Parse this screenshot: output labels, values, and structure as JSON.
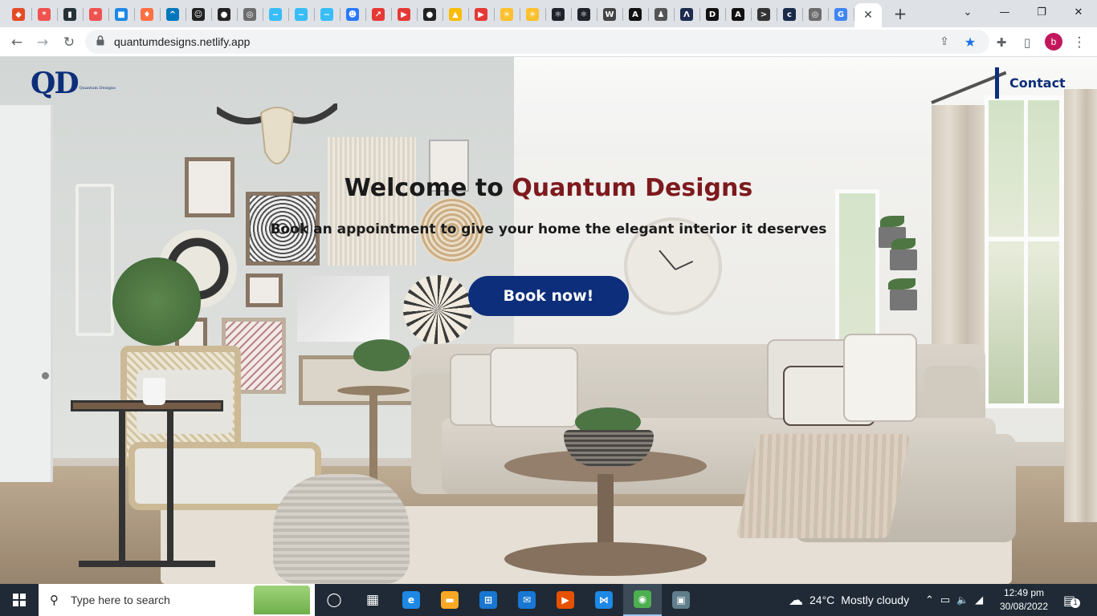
{
  "browser": {
    "tabs": [
      {
        "icon": "generic-favicon",
        "color": "#e34c26",
        "glyph": "◆"
      },
      {
        "icon": "asterisk-favicon",
        "color": "#ef5350",
        "glyph": "*"
      },
      {
        "icon": "chart-favicon",
        "color": "#263238",
        "glyph": "▮"
      },
      {
        "icon": "asterisk-favicon",
        "color": "#ef5350",
        "glyph": "*"
      },
      {
        "icon": "puzzle-favicon",
        "color": "#1e88e5",
        "glyph": "■"
      },
      {
        "icon": "flame-favicon",
        "color": "#ff7043",
        "glyph": "♦"
      },
      {
        "icon": "chevron-favicon",
        "color": "#0277bd",
        "glyph": "^"
      },
      {
        "icon": "face-favicon",
        "color": "#222222",
        "glyph": "☺"
      },
      {
        "icon": "github-favicon",
        "color": "#222222",
        "glyph": "●"
      },
      {
        "icon": "globe-favicon",
        "color": "#6d6d6d",
        "glyph": "◎"
      },
      {
        "icon": "tailwind-favicon",
        "color": "#38bdf8",
        "glyph": "~"
      },
      {
        "icon": "tailwind-favicon",
        "color": "#38bdf8",
        "glyph": "~"
      },
      {
        "icon": "tailwind-favicon",
        "color": "#38bdf8",
        "glyph": "~"
      },
      {
        "icon": "robot-favicon",
        "color": "#2979ff",
        "glyph": "☻"
      },
      {
        "icon": "red-square-favicon",
        "color": "#e53935",
        "glyph": "↗"
      },
      {
        "icon": "youtube-favicon",
        "color": "#e53935",
        "glyph": "▶"
      },
      {
        "icon": "github-favicon",
        "color": "#222222",
        "glyph": "●"
      },
      {
        "icon": "drive-favicon",
        "color": "#fbbc04",
        "glyph": "▲"
      },
      {
        "icon": "youtube-favicon",
        "color": "#e53935",
        "glyph": "▶"
      },
      {
        "icon": "sun-favicon",
        "color": "#fbc02d",
        "glyph": "☀"
      },
      {
        "icon": "sun-favicon",
        "color": "#fbc02d",
        "glyph": "☀"
      },
      {
        "icon": "react-favicon",
        "color": "#20232a",
        "glyph": "⚛"
      },
      {
        "icon": "react-favicon",
        "color": "#20232a",
        "glyph": "⚛"
      },
      {
        "icon": "w-favicon",
        "color": "#444444",
        "glyph": "W"
      },
      {
        "icon": "a-favicon",
        "color": "#111111",
        "glyph": "A"
      },
      {
        "icon": "person-favicon",
        "color": "#555555",
        "glyph": "♟"
      },
      {
        "icon": "a-slash-favicon",
        "color": "#1d2b4f",
        "glyph": "Λ"
      },
      {
        "icon": "d-favicon",
        "color": "#111111",
        "glyph": "D"
      },
      {
        "icon": "a-circle-favicon",
        "color": "#111111",
        "glyph": "A"
      },
      {
        "icon": "terminal-favicon",
        "color": "#333333",
        "glyph": ">"
      },
      {
        "icon": "c-favicon",
        "color": "#1b2a4a",
        "glyph": "c"
      },
      {
        "icon": "globe-favicon",
        "color": "#6d6d6d",
        "glyph": "◎"
      },
      {
        "icon": "google-favicon",
        "color": "#4285f4",
        "glyph": "G"
      }
    ],
    "active_tab_close": "✕",
    "new_tab": "+",
    "window_controls": {
      "dropdown": "⌄",
      "minimize": "—",
      "restore": "❐",
      "close": "✕"
    },
    "nav": {
      "back": "←",
      "forward": "→",
      "reload": "↻"
    },
    "url": "quantumdesigns.netlify.app",
    "omnibox_icons": {
      "share": "⇪",
      "bookmark": "★",
      "extensions": "✚",
      "sidepanel": "▯",
      "menu": "⋮"
    },
    "profile_initial": "b",
    "colors": {
      "tabstrip": "#dee1e6",
      "bookmark_star": "#1a73e8",
      "profile": "#c2185b"
    }
  },
  "site": {
    "logo_mark": "QD",
    "logo_subtitle": "Quantum Designs",
    "nav_contact": "Contact",
    "headline_prefix": "Welcome to ",
    "headline_brand": "Quantum Designs",
    "subheadline": "Book an appointment to give your home the elegant interior it deserves",
    "cta_label": "Book now!",
    "colors": {
      "primary": "#0d2e7a",
      "brand_accent": "#7d1a1d",
      "text": "#1a1a1a"
    },
    "hero_image": "living-room-interior"
  },
  "taskbar": {
    "search_placeholder": "Type here to search",
    "apps": [
      {
        "name": "task-view",
        "glyph": "◯",
        "color": "transparent"
      },
      {
        "name": "task-switcher",
        "glyph": "▦",
        "color": "transparent"
      },
      {
        "name": "edge",
        "glyph": "e",
        "color": "#1e88e5"
      },
      {
        "name": "file-explorer",
        "glyph": "▬",
        "color": "#f9a825"
      },
      {
        "name": "store",
        "glyph": "⊞",
        "color": "#1976d2"
      },
      {
        "name": "mail",
        "glyph": "✉",
        "color": "#1976d2"
      },
      {
        "name": "media-player",
        "glyph": "▶",
        "color": "#e65100"
      },
      {
        "name": "vscode",
        "glyph": "⋈",
        "color": "#1e88e5"
      },
      {
        "name": "chrome",
        "glyph": "◉",
        "color": "#4caf50"
      },
      {
        "name": "remote-desktop",
        "glyph": "▣",
        "color": "#607d8b"
      }
    ],
    "weather_temp": "24°C",
    "weather_text": "Mostly cloudy",
    "tray_icons": {
      "chevron": "⌃",
      "battery": "▭",
      "volume": "🔈",
      "network": "◢"
    },
    "time": "12:49 pm",
    "date": "30/08/2022",
    "notification_count": "1"
  }
}
